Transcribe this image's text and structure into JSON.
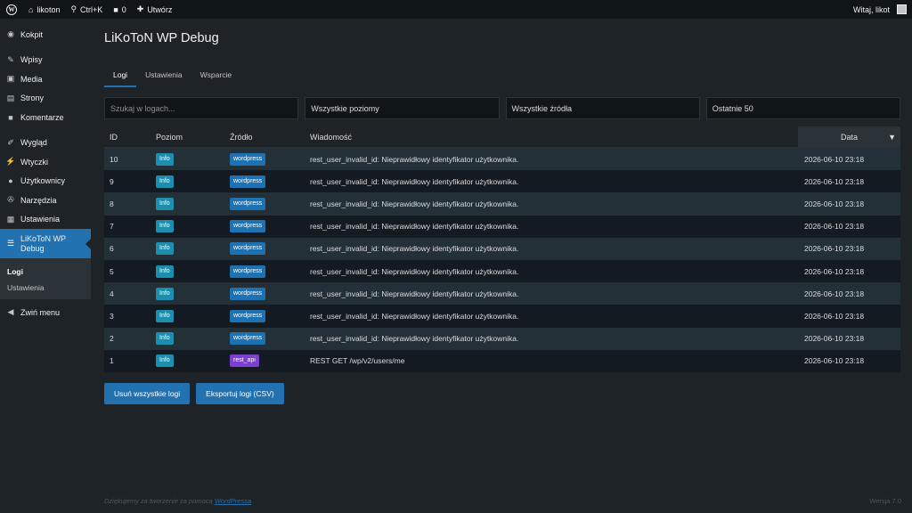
{
  "adminbar": {
    "site_name": "likoton",
    "search_label": "Ctrl+K",
    "comments_count": "0",
    "new_label": "Utwórz",
    "greeting": "Witaj, likot"
  },
  "sidebar": {
    "items": [
      {
        "label": "Kokpit",
        "icon": "dashboard-icon"
      },
      {
        "label": "Wpisy",
        "icon": "pin-icon"
      },
      {
        "label": "Media",
        "icon": "media-icon"
      },
      {
        "label": "Strony",
        "icon": "pages-icon"
      },
      {
        "label": "Komentarze",
        "icon": "comment-icon"
      },
      {
        "label": "Wygląd",
        "icon": "brush-icon"
      },
      {
        "label": "Wtyczki",
        "icon": "plugin-icon"
      },
      {
        "label": "Użytkownicy",
        "icon": "users-icon"
      },
      {
        "label": "Narzędzia",
        "icon": "wrench-icon"
      },
      {
        "label": "Ustawienia",
        "icon": "settings-icon"
      }
    ],
    "current": {
      "label_1": "LiKoToN WP",
      "label_2": "Debug"
    },
    "submenu": [
      "Logi",
      "Ustawienia"
    ],
    "collapse_label": "Zwiń menu"
  },
  "page": {
    "title": "LiKoToN WP Debug",
    "tabs": [
      "Logi",
      "Ustawienia",
      "Wsparcie"
    ]
  },
  "filters": {
    "search_placeholder": "Szukaj w logach...",
    "level": "Wszystkie poziomy",
    "source": "Wszystkie źródła",
    "limit": "Ostatnie 50"
  },
  "table": {
    "headers": {
      "id": "ID",
      "level": "Poziom",
      "source": "Źródło",
      "message": "Wiadomość",
      "date": "Data"
    },
    "sort_indicator": "▼",
    "rows": [
      {
        "id": "10",
        "level": "Info",
        "source": "wordpress",
        "message": "rest_user_invalid_id: Nieprawidłowy identyfikator użytkownika.",
        "date": "2026-06-10 23:18"
      },
      {
        "id": "9",
        "level": "Info",
        "source": "wordpress",
        "message": "rest_user_invalid_id: Nieprawidłowy identyfikator użytkownika.",
        "date": "2026-06-10 23:18"
      },
      {
        "id": "8",
        "level": "Info",
        "source": "wordpress",
        "message": "rest_user_invalid_id: Nieprawidłowy identyfikator użytkownika.",
        "date": "2026-06-10 23:18"
      },
      {
        "id": "7",
        "level": "Info",
        "source": "wordpress",
        "message": "rest_user_invalid_id: Nieprawidłowy identyfikator użytkownika.",
        "date": "2026-06-10 23:18"
      },
      {
        "id": "6",
        "level": "Info",
        "source": "wordpress",
        "message": "rest_user_invalid_id: Nieprawidłowy identyfikator użytkownika.",
        "date": "2026-06-10 23:18"
      },
      {
        "id": "5",
        "level": "Info",
        "source": "wordpress",
        "message": "rest_user_invalid_id: Nieprawidłowy identyfikator użytkownika.",
        "date": "2026-06-10 23:18"
      },
      {
        "id": "4",
        "level": "Info",
        "source": "wordpress",
        "message": "rest_user_invalid_id: Nieprawidłowy identyfikator użytkownika.",
        "date": "2026-06-10 23:18"
      },
      {
        "id": "3",
        "level": "Info",
        "source": "wordpress",
        "message": "rest_user_invalid_id: Nieprawidłowy identyfikator użytkownika.",
        "date": "2026-06-10 23:18"
      },
      {
        "id": "2",
        "level": "Info",
        "source": "wordpress",
        "message": "rest_user_invalid_id: Nieprawidłowy identyfikator użytkownika.",
        "date": "2026-06-10 23:18"
      },
      {
        "id": "1",
        "level": "Info",
        "source": "rest_api",
        "message": "REST GET /wp/v2/users/me",
        "date": "2026-06-10 23:18"
      }
    ]
  },
  "actions": {
    "delete_all": "Usuń wszystkie logi",
    "export": "Eksportuj logi (CSV)"
  },
  "footer": {
    "thanks_prefix": "Dziękujemy za tworzenie za pomocą",
    "wp_link": "WordPressa",
    "thanks_suffix": ".",
    "version": "Wersja 7.0"
  },
  "colors": {
    "accent": "#2271b1",
    "badge_info": "#1b8fad",
    "badge_wordpress": "#1e72b1",
    "badge_rest_api": "#7c3fd1"
  }
}
